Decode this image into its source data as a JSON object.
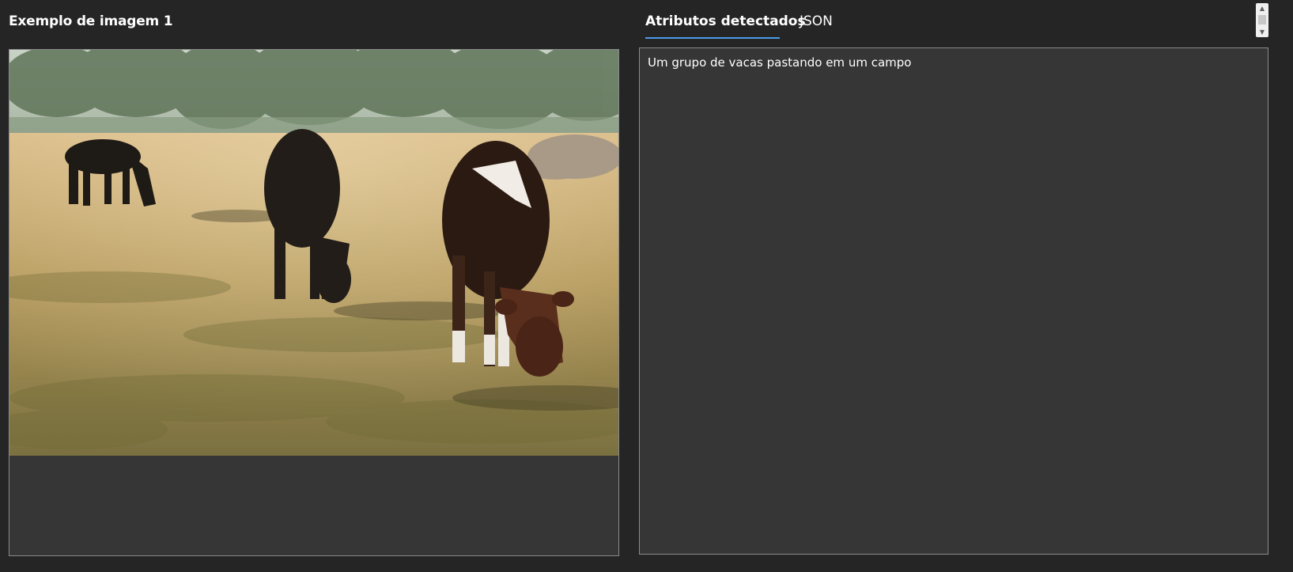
{
  "left_panel": {
    "title": "Exemplo de imagem 1"
  },
  "right_panel": {
    "tabs": [
      {
        "label": "Atributos detectados",
        "active": true
      },
      {
        "label": "JSON",
        "active": false
      }
    ],
    "result_text": "Um grupo de vacas pastando em um campo"
  },
  "colors": {
    "background": "#252525",
    "panel": "#363636",
    "accent": "#4a9ae8"
  },
  "icons": [
    "scroll-up-arrow-icon",
    "scroll-down-arrow-icon"
  ]
}
